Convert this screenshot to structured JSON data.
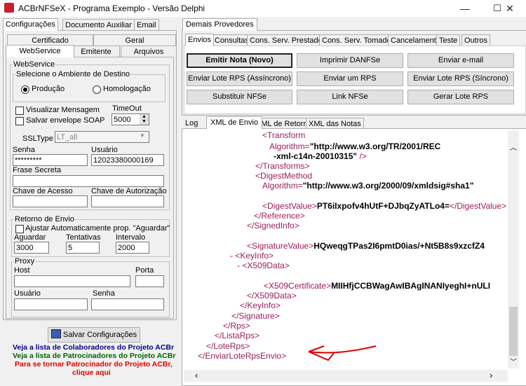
{
  "window": {
    "title": "ACBrNFSeX - Programa Exemplo - Versão Delphi",
    "minimize": "—",
    "maximize": "☐",
    "close": "✕"
  },
  "left": {
    "top_tabs": [
      "Configurações",
      "Documento Auxiliar",
      "Email"
    ],
    "sub_tabs_row1": [
      "Certificado",
      "Geral"
    ],
    "sub_tabs_row2": [
      "WebService",
      "Emitente",
      "Arquivos"
    ],
    "webservice_caption": "WebService",
    "ambiente_caption": "Selecione o Ambiente de Destino",
    "radio_producao": "Produção",
    "radio_homologacao": "Homologação",
    "chk_visualizar": "Visualizar Mensagem",
    "chk_salvar": "Salvar envelope SOAP",
    "timeout_label": "TimeOut",
    "timeout_value": "5000",
    "ssltype_label": "SSLType",
    "ssltype_value": "LT_all",
    "senha_label": "Senha",
    "senha_value": "*********",
    "usuario_label": "Usuário",
    "usuario_value": "12023380000169",
    "frase_label": "Frase Secreta",
    "chave_acesso_label": "Chave de Acesso",
    "chave_autorizacao_label": "Chave de Autorização",
    "retorno_caption": "Retorno de Envio",
    "chk_ajustar": "Ajustar Automaticamente prop. \"Aguardar\"",
    "aguardar_label": "Aguardar",
    "aguardar_value": "3000",
    "tentativas_label": "Tentativas",
    "tentativas_value": "5",
    "intervalo_label": "Intervalo",
    "intervalo_value": "2000",
    "proxy_caption": "Proxy",
    "host_label": "Host",
    "porta_label": "Porta",
    "proxy_usuario_label": "Usuário",
    "proxy_senha_label": "Senha",
    "salvar_button": "Salvar Configurações",
    "link1": "Veja a lista de Colaboradores do Projeto ACBr",
    "link2": "Veja a lista de Patrocinadores do Projeto ACBr",
    "link3a": "Para se tornar Patrocinador do Projeto ACBr,",
    "link3b": "clique aqui"
  },
  "right": {
    "provider_tab": "Demais Provedores",
    "tabs": [
      "Envios",
      "Consultas",
      "Cons. Serv. Prestados",
      "Cons. Serv. Tomados",
      "Cancelamento",
      "Teste",
      "Outros"
    ],
    "buttons": [
      [
        "Emitir Nota (Novo)",
        "Imprimir DANFSe",
        "Enviar e-mail"
      ],
      [
        "Enviar Lote RPS (Assíncrono)",
        "Enviar um RPS",
        "Enviar Lote RPS (Síncrono)"
      ],
      [
        "Substituir NFSe",
        "Link NFSe",
        "Gerar Lote RPS"
      ]
    ],
    "bottom_tabs": [
      "Log",
      "XML de Envio",
      "XML de Retorno",
      "XML das Notas"
    ]
  },
  "xml": {
    "l1_tag": "<Transform",
    "l2_attr": "Algorithm=",
    "l2_val": "\"http://www.w3.org/TR/2001/REC",
    "l3_val": "-xml-c14n-20010315\"",
    "l3_end": " />",
    "l4": "</Transforms>",
    "l5": "<DigestMethod",
    "l6_attr": "Algorithm=",
    "l6_val": "\"http://www.w3.org/2000/09/xmldsig#sha1\"",
    "l7_open": "<DigestValue>",
    "l7_text": "PT6iIxpofv4hUtF+DJbqZyATLo4=",
    "l7_close": "</DigestValue>",
    "l8": "</Reference>",
    "l9": "</SignedInfo>",
    "l10_open": "<SignatureValue>",
    "l10_text": "HQweqgTPas2I6pmtD0ias/+Nt5B8s9xzcfZ4",
    "l11": "<KeyInfo>",
    "l12": "<X509Data>",
    "l13_open": "<X509Certificate>",
    "l13_text": "MIIHfjCCBWagAwIBAgINANIyeghI+nULI",
    "l14": "</X509Data>",
    "l15": "</KeyInfo>",
    "l16": "</Signature>",
    "l17": "</Rps>",
    "l18": "</ListaRps>",
    "l19": "</LoteRps>",
    "l20": "</EnviarLoteRpsEnvio>",
    "minus": "-"
  }
}
